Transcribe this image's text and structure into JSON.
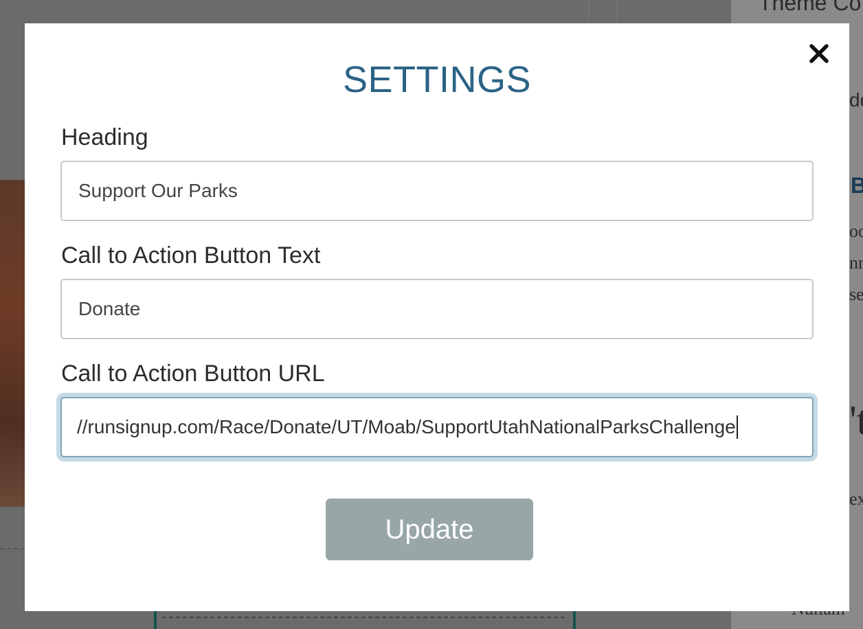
{
  "modal": {
    "title": "SETTINGS",
    "close_icon": "close-icon"
  },
  "fields": {
    "heading": {
      "label": "Heading",
      "value": "Support Our Parks"
    },
    "cta_text": {
      "label": "Call to Action Button Text",
      "value": "Donate"
    },
    "cta_url": {
      "label": "Call to Action Button URL",
      "value": "//runsignup.com/Race/Donate/UT/Moab/SupportUtahNationalParksChallenge"
    }
  },
  "actions": {
    "update_label": "Update"
  },
  "background": {
    "partial_text_top": "Theme Co",
    "partial_text_1": "dd",
    "partial_text_2": "B",
    "partial_text_3": "oo",
    "partial_text_4": "nn",
    "partial_text_5": "se",
    "partial_text_6": "'t",
    "partial_text_7": "ex",
    "partial_text_bottom": "Nullam"
  },
  "colors": {
    "title": "#2b6386",
    "button_bg": "#98a6a8",
    "focus_ring": "#c4dbe6",
    "overlay": "#6b6b6b"
  }
}
